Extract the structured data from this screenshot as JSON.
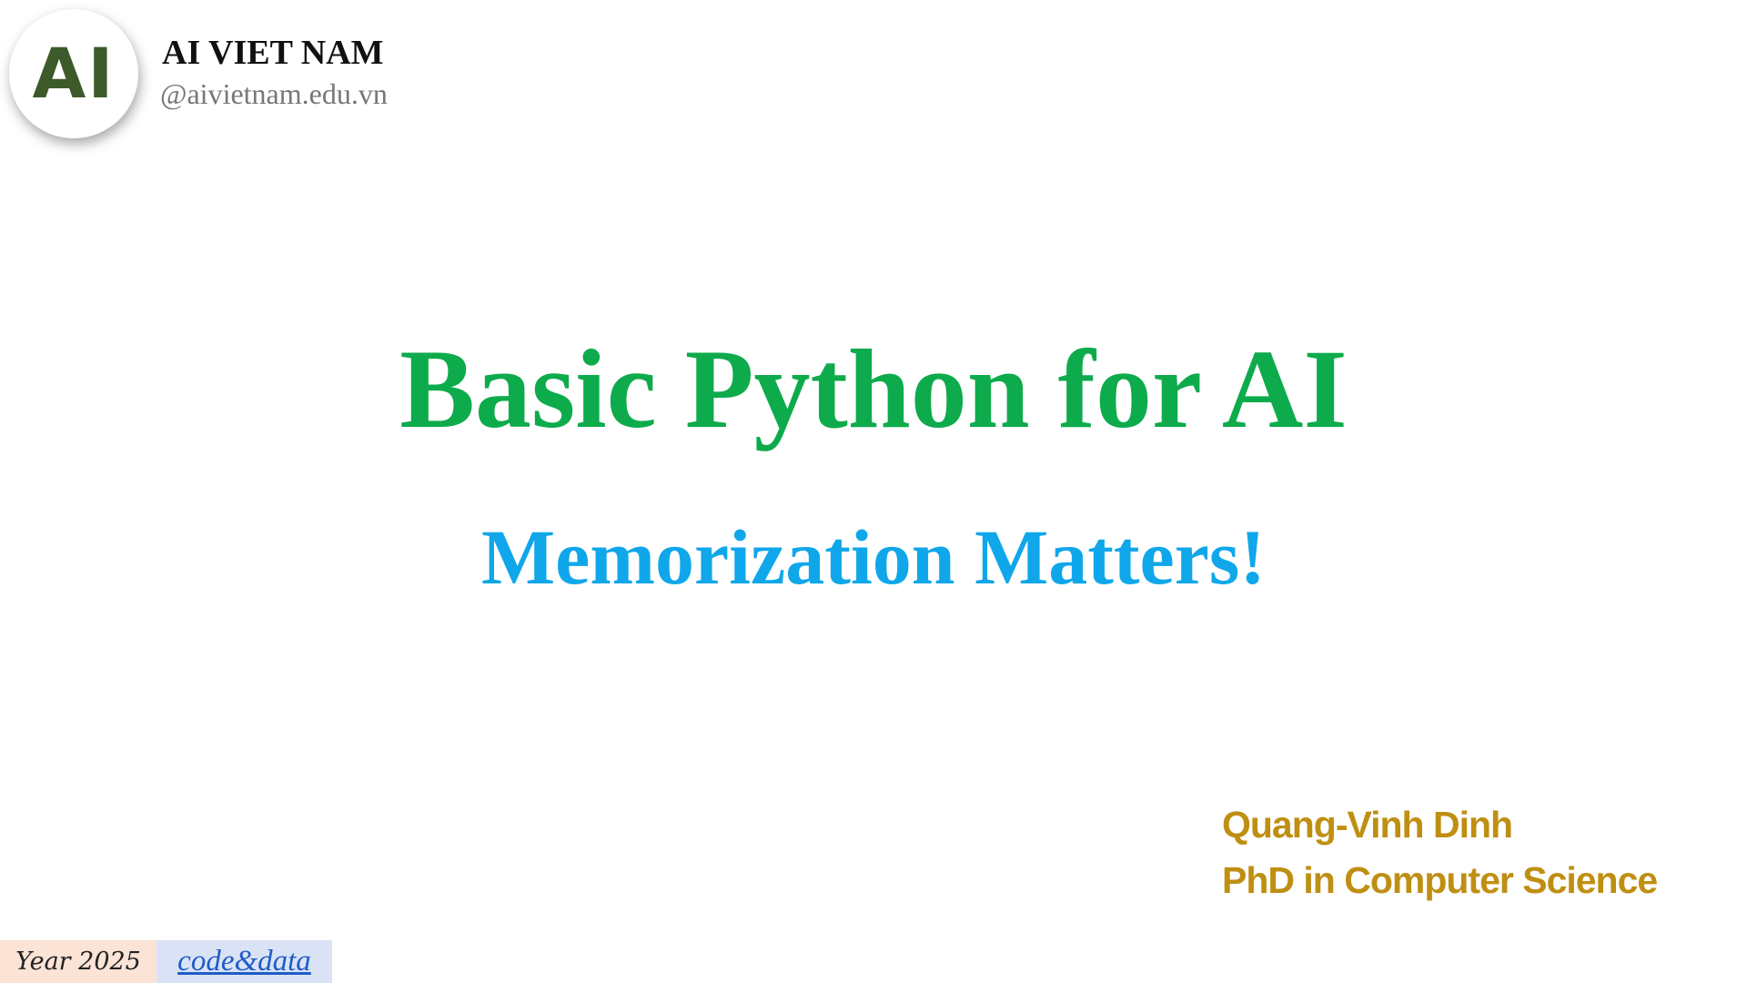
{
  "brand": {
    "logo_text": "AI",
    "name": "AI VIET NAM",
    "url": "@aivietnam.edu.vn"
  },
  "slide": {
    "title": "Basic Python for AI",
    "subtitle": "Memorization Matters!"
  },
  "author": {
    "name": "Quang-Vinh Dinh",
    "degree": "PhD in Computer Science"
  },
  "footer": {
    "year_label": "Year 2025",
    "link_label": "code&data"
  },
  "colors": {
    "title": "#0eab4c",
    "subtitle": "#10a7ea",
    "author": "#bf8f12",
    "logo": "#3d5a2a",
    "link": "#1f5cc7"
  }
}
